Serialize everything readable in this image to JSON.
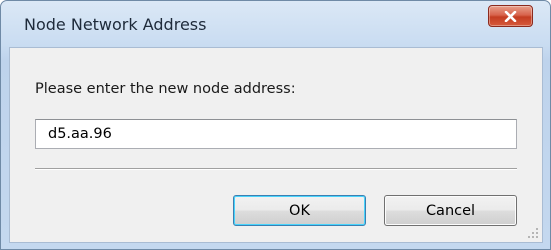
{
  "window": {
    "title": "Node Network Address",
    "close_icon": "close-icon"
  },
  "dialog": {
    "prompt": "Please enter the new node address:",
    "address_value": "d5.aa.96"
  },
  "buttons": {
    "ok_label": "OK",
    "cancel_label": "Cancel"
  },
  "colors": {
    "title_bar": "#c9dcf1",
    "client_background": "#f0f0f0",
    "close_button": "#c43d22",
    "default_button_border": "#3c7fb1"
  }
}
